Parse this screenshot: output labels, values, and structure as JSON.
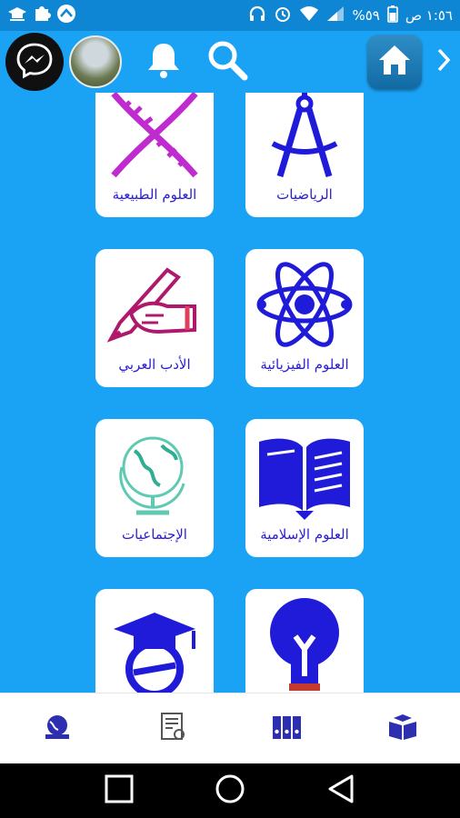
{
  "status_bar": {
    "time": "١:٥٦ ص",
    "battery": "%٥٩",
    "icons": [
      "wifi-icon",
      "signal-icon",
      "alarm-icon",
      "headphones-icon"
    ]
  },
  "top_bar": {
    "icons": [
      "messenger-icon",
      "bell-icon",
      "search-icon",
      "home-icon",
      "chevron-right-icon"
    ]
  },
  "subjects": [
    {
      "label": "الرياضيات",
      "icon": "compass-icon"
    },
    {
      "label": "العلوم الطبيعية",
      "icon": "dna-icon"
    },
    {
      "label": "العلوم الفيزيائية",
      "icon": "atom-icon"
    },
    {
      "label": "الأدب العربي",
      "icon": "writing-hand-icon"
    },
    {
      "label": "العلوم الإسلامية",
      "icon": "open-book-icon"
    },
    {
      "label": "الإجتماعيات",
      "icon": "globe-icon"
    },
    {
      "label": "",
      "icon": "lightbulb-icon"
    },
    {
      "label": "",
      "icon": "graduation-cap-icon"
    }
  ],
  "bottom_nav": [
    "globe-books-icon",
    "certificate-icon",
    "binders-icon",
    "reading-book-icon"
  ],
  "colors": {
    "header": "#1aa3f5",
    "statusbar": "#0f86d4",
    "label": "#2a1fcf",
    "dna": "#c02bd0"
  }
}
